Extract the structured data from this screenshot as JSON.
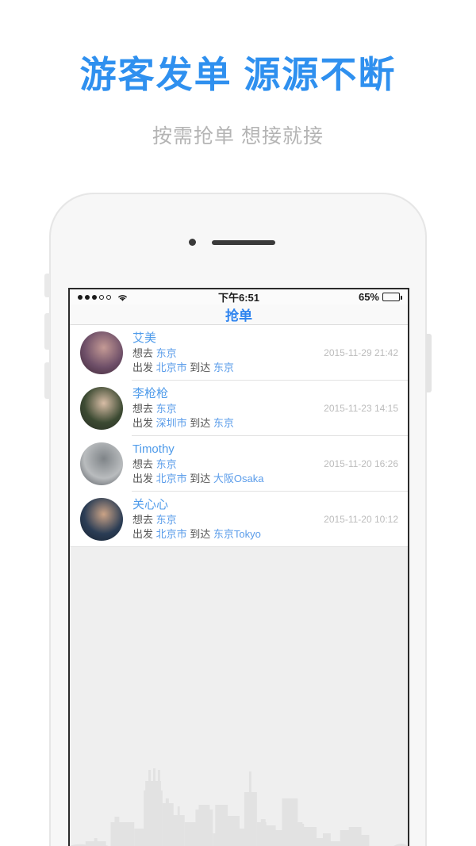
{
  "promo": {
    "headline": "游客发单 源源不断",
    "subhead": "按需抢单 想接就接",
    "headline_color": "#2f90ef",
    "subhead_color": "#b4b4b4"
  },
  "device": {
    "frame_color": "#f7f7f7",
    "screen_bg": "#efefef"
  },
  "statusbar": {
    "signal_dots_filled": 3,
    "signal_dots_total": 5,
    "wifi_icon": "wifi-icon",
    "time": "下午6:51",
    "battery_percent": "65%",
    "battery_level": 65
  },
  "navbar": {
    "title": "抢单",
    "title_color": "#2f84ef"
  },
  "list": {
    "labels": {
      "want": "想去",
      "depart": "出发",
      "arrive": "到达"
    },
    "rows": [
      {
        "name": "艾美",
        "want_to": "东京",
        "from": "北京市",
        "to": "东京",
        "date": "2015-11-29 21:42",
        "avatar_colors": [
          "#6e4f68",
          "#c49a95",
          "#3b2433"
        ]
      },
      {
        "name": "李枪枪",
        "want_to": "东京",
        "from": "深圳市",
        "to": "东京",
        "date": "2015-11-23 14:15",
        "avatar_colors": [
          "#3c4a32",
          "#d8bda6",
          "#262b22"
        ]
      },
      {
        "name": "Timothy",
        "want_to": "东京",
        "from": "北京市",
        "to": "大阪Osaka",
        "date": "2015-11-20 16:26",
        "avatar_colors": [
          "#b9bcbe",
          "#7f8488",
          "#4a4e55"
        ]
      },
      {
        "name": "关心心",
        "want_to": "东京",
        "from": "北京市",
        "to": "东京Tokyo",
        "date": "2015-11-20 10:12",
        "avatar_colors": [
          "#2b3d55",
          "#cba386",
          "#16202e"
        ]
      }
    ]
  },
  "footer": {
    "skyline_icon": "city-skyline-icon",
    "skyline_color": "#e2e2e2",
    "background_color": "#efefef"
  }
}
